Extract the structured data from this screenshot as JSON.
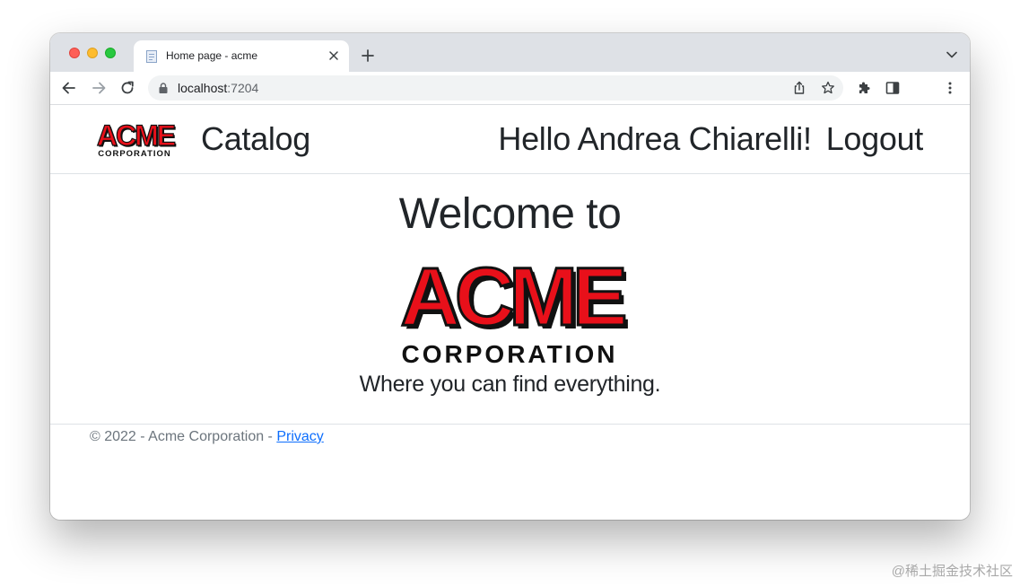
{
  "browser": {
    "tab_title": "Home page - acme",
    "url_host": "localhost",
    "url_port": ":7204"
  },
  "site": {
    "logo_main": "ACME",
    "logo_sub": "CORPORATION",
    "nav_catalog": "Catalog",
    "greeting": "Hello Andrea Chiarelli!",
    "logout": "Logout"
  },
  "main": {
    "welcome": "Welcome to",
    "tagline": "Where you can find everything."
  },
  "footer": {
    "copyright": "© 2022 - Acme Corporation - ",
    "privacy_link": "Privacy"
  },
  "watermark": "@稀土掘金技术社区",
  "colors": {
    "logo_red": "#e8101a",
    "link_blue": "#0d6efd",
    "text_dark": "#212529",
    "text_muted": "#6c757d"
  }
}
